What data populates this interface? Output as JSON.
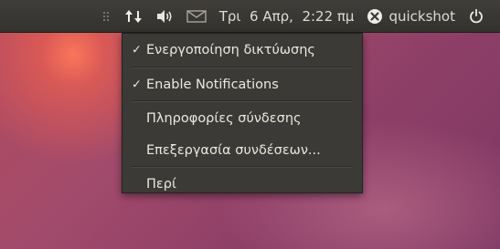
{
  "panel": {
    "date_time": "Τρι  6 Απρ,  2:22 πμ",
    "username": "quickshot",
    "icons": [
      "network-icon",
      "volume-icon",
      "mail-icon",
      "user-status-icon",
      "power-icon"
    ]
  },
  "network_menu": {
    "items": [
      {
        "label": "Ενεργοποίηση δικτύωσης",
        "checked": true,
        "check": "✓"
      },
      {
        "label": "Enable Notifications",
        "checked": true,
        "check": "✓"
      },
      {
        "label": "Πληροφορίες σύνδεσης",
        "checked": false
      },
      {
        "label": "Επεξεργασία συνδέσεων...",
        "checked": false
      },
      {
        "label": "Περί",
        "checked": false
      }
    ]
  }
}
